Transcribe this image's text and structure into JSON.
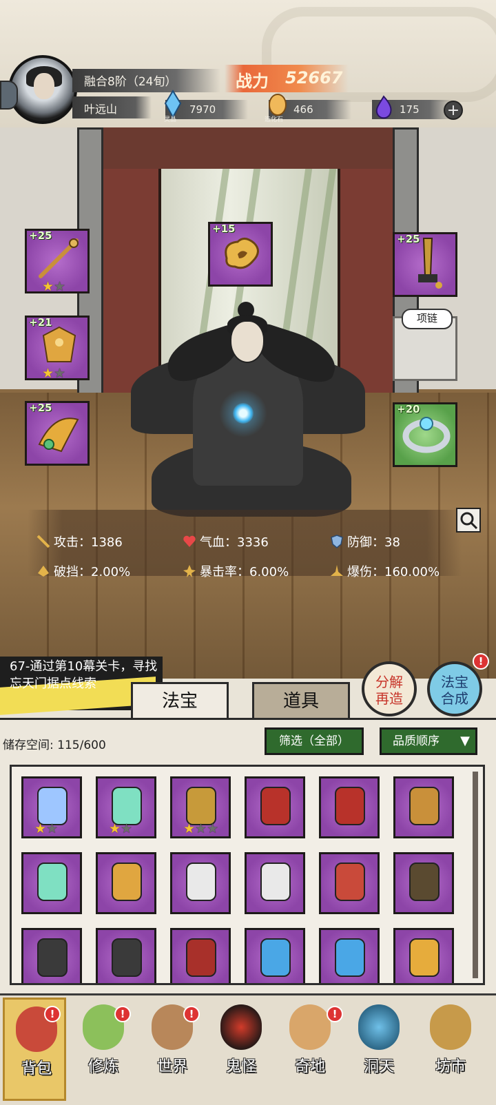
{
  "header": {
    "realm": "融合8阶（24旬）",
    "player_name": "叶远山",
    "power_label": "战力",
    "power_value": "52667",
    "resources": [
      {
        "icon": "spirit-crystal-icon",
        "sub": "灵晶",
        "value": "7970"
      },
      {
        "icon": "creation-stone-icon",
        "sub": "造化石",
        "value": "466"
      },
      {
        "icon": "purple-flame-icon",
        "value": "175"
      }
    ],
    "plus_label": "+"
  },
  "equipment": {
    "left": [
      {
        "icon": "staff-icon",
        "level": "+25",
        "stars_on": "★",
        "stars_off": "★"
      },
      {
        "icon": "golden-armor-icon",
        "level": "+21",
        "stars_on": "★",
        "stars_off": "★"
      },
      {
        "icon": "winged-helm-icon",
        "level": "+25"
      }
    ],
    "center": {
      "icon": "cloud-talisman-icon",
      "level": "+15"
    },
    "right": [
      {
        "icon": "blade-icon",
        "level": "+25"
      },
      {
        "icon": "empty-necklace-slot",
        "label": "项链"
      },
      {
        "icon": "silver-bracelet-icon",
        "level": "+20"
      }
    ]
  },
  "stats": [
    {
      "icon": "sword-icon",
      "label": "攻击：",
      "value": "1386"
    },
    {
      "icon": "heart-icon",
      "label": "气血：",
      "value": "3336"
    },
    {
      "icon": "shield-icon",
      "label": "防御：",
      "value": "38"
    },
    {
      "icon": "break-icon",
      "label": "破挡：",
      "value": "2.00%"
    },
    {
      "icon": "crit-icon",
      "label": "暴击率：",
      "value": "6.00%"
    },
    {
      "icon": "crit-damage-icon",
      "label": "爆伤：",
      "value": "160.00%"
    }
  ],
  "quest": {
    "text": "67-通过第10幕关卡，寻找忘天门据点线索"
  },
  "tabs": [
    {
      "label": "法宝",
      "active": true
    },
    {
      "label": "道具",
      "active": false
    }
  ],
  "actions": {
    "decompose": "分解再造",
    "synthesize": "法宝合成",
    "synthesize_badge": "!"
  },
  "inventory": {
    "storage_label": "储存空间:",
    "storage_value": "115/600",
    "filter": "筛选（全部）",
    "sort": "品质顺序",
    "sort_icon": "chevron-down-icon",
    "items": [
      {
        "icon": "blue-sword-icon",
        "stars_on": "★",
        "stars_off": "★"
      },
      {
        "icon": "jade-fan-icon",
        "stars_on": "★",
        "stars_off": "★"
      },
      {
        "icon": "blade-icon",
        "stars_on": "★",
        "stars_off": "★★"
      },
      {
        "icon": "red-claw-icon"
      },
      {
        "icon": "red-claw-icon"
      },
      {
        "icon": "staff-icon"
      },
      {
        "icon": "jade-fan-icon"
      },
      {
        "icon": "golden-armor-icon"
      },
      {
        "icon": "white-robe-icon"
      },
      {
        "icon": "white-robe-icon"
      },
      {
        "icon": "red-armor-icon"
      },
      {
        "icon": "dark-robe-icon"
      },
      {
        "icon": "bracer-icon"
      },
      {
        "icon": "bracer-icon"
      },
      {
        "icon": "red-gauntlet-icon"
      },
      {
        "icon": "blue-crystal-icon"
      },
      {
        "icon": "blue-crystal-icon"
      },
      {
        "icon": "winged-helm-icon"
      }
    ]
  },
  "nav": [
    {
      "label": "背包",
      "icon": "bag-icon",
      "active": true,
      "badge": "!"
    },
    {
      "label": "修炼",
      "icon": "lotus-icon",
      "badge": "!"
    },
    {
      "label": "世界",
      "icon": "scroll-map-icon",
      "badge": "!"
    },
    {
      "label": "鬼怪",
      "icon": "demon-egg-icon"
    },
    {
      "label": "奇地",
      "icon": "mountain-icon",
      "badge": "!"
    },
    {
      "label": "洞天",
      "icon": "portal-icon"
    },
    {
      "label": "坊市",
      "icon": "market-icon"
    }
  ],
  "colors": {
    "rarity_purple": "#8d45a8",
    "rarity_green": "#58a14a",
    "accent_gold": "#e9c768",
    "power_orange": "#e9683a",
    "badge_red": "#d33333"
  }
}
